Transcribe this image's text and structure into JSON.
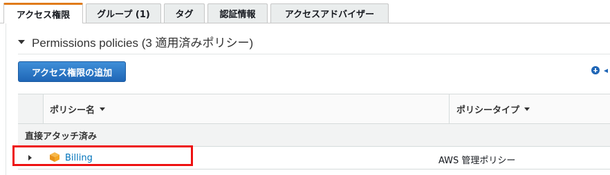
{
  "tabs": [
    {
      "label": "アクセス権限"
    },
    {
      "label": "グループ (1)"
    },
    {
      "label": "タグ"
    },
    {
      "label": "認証情報"
    },
    {
      "label": "アクセスアドバイザー"
    }
  ],
  "section": {
    "title": "Permissions policies (3 適用済みポリシー)"
  },
  "add_button": {
    "label": "アクセス権限の追加"
  },
  "arrow_glyph": "◂",
  "table": {
    "columns": {
      "name": "ポリシー名",
      "type": "ポリシータイプ"
    },
    "group": {
      "label": "直接アタッチ済み"
    },
    "rows": [
      {
        "name": "Billing",
        "type": "AWS 管理ポリシー"
      }
    ]
  },
  "colors": {
    "active_tab_accent": "#e07b1a",
    "primary_button": "#1f66b6",
    "link": "#0073bb",
    "highlight": "#ee1111",
    "policy_icon": "#f5a623"
  }
}
